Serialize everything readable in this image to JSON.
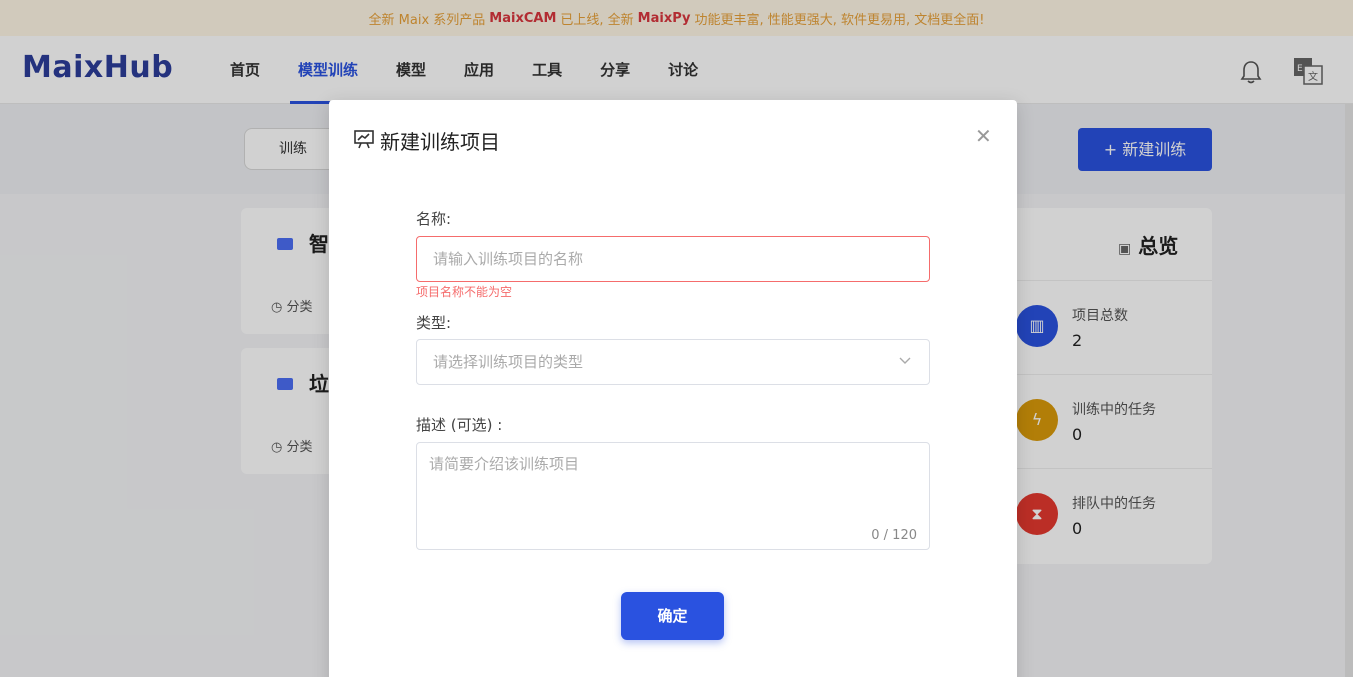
{
  "announcement": {
    "prefix": "全新 Maix 系列产品",
    "product1": "MaixCAM",
    "mid": "已上线, 全新",
    "product2": "MaixPy",
    "suffix": "功能更丰富, 性能更强大, 软件更易用, 文档更全面!"
  },
  "header": {
    "logo": "MaixHub",
    "nav": [
      "首页",
      "模型训练",
      "模型",
      "应用",
      "工具",
      "分享",
      "讨论"
    ],
    "active_nav": "模型训练"
  },
  "page": {
    "tab_label": "训练",
    "new_button": "+ 新建训练",
    "cards": [
      {
        "title": "智",
        "category": "分类"
      },
      {
        "title": "垃",
        "category": "分类"
      }
    ],
    "overview": {
      "title": "总览",
      "items": [
        {
          "label": "项目总数",
          "value": "2",
          "color": "#2a52e0"
        },
        {
          "label": "训练中的任务",
          "value": "0",
          "color": "#d99a0a"
        },
        {
          "label": "排队中的任务",
          "value": "0",
          "color": "#e5392f"
        }
      ]
    }
  },
  "dialog": {
    "title": "新建训练项目",
    "name_label": "名称:",
    "name_placeholder": "请输入训练项目的名称",
    "name_error": "项目名称不能为空",
    "type_label": "类型:",
    "type_placeholder": "请选择训练项目的类型",
    "desc_label": "描述 (可选) :",
    "desc_placeholder": "请简要介绍该训练项目",
    "desc_counter": "0 / 120",
    "confirm": "确定"
  }
}
